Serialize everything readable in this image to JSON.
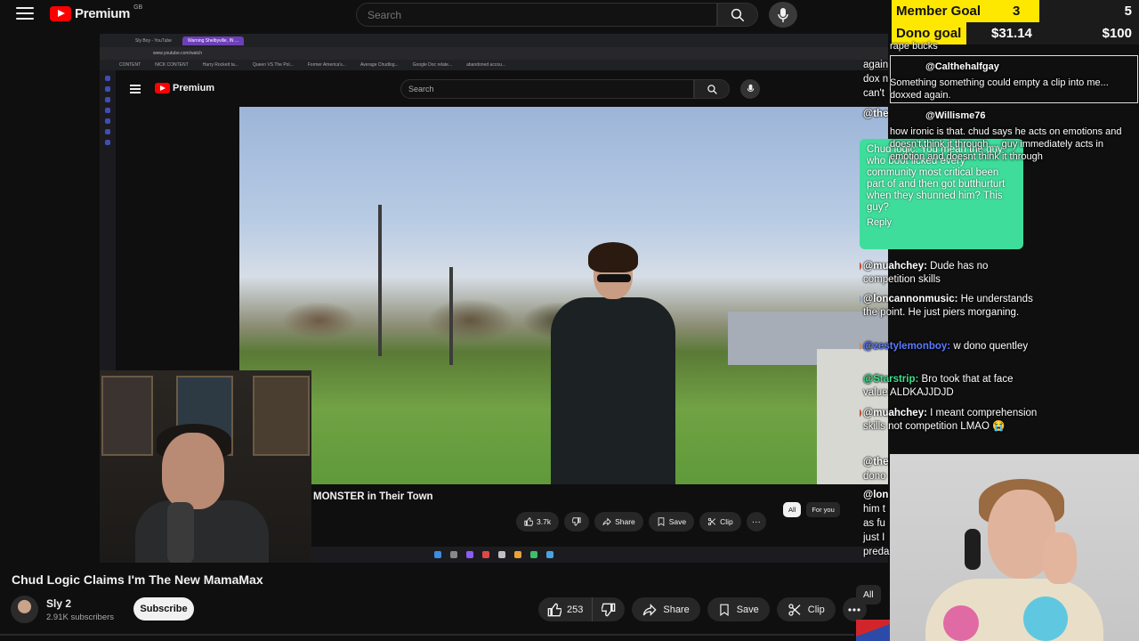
{
  "header": {
    "logo_text": "Premium",
    "logo_region": "GB",
    "search_placeholder": "Search"
  },
  "goals": {
    "member_label": "Member Goal",
    "member_current": "3",
    "member_target": "5",
    "dono_label": "Dono goal",
    "dono_current": "$31.14",
    "dono_target": "$100"
  },
  "capture": {
    "tabs": [
      "Sly Boy - YouTube",
      "Warning Shelbyville, IN ..."
    ],
    "url": "www.youtube.com/watch",
    "bookmarks": [
      "CONTENT",
      "NICK CONTENT",
      "Harry Rockett ta...",
      "Queen VS The Pol...",
      "Former America's...",
      "Average Chudlog...",
      "Google Doc relate...",
      "abandoned accou..."
    ],
    "logo_text": "Premium",
    "logo_region": "GB",
    "search_placeholder": "Search",
    "video_title": "MONSTER in Their Town",
    "like_count": "3.7k",
    "share_label": "Share",
    "save_label": "Save",
    "clip_label": "Clip",
    "chips": [
      "All",
      "For you"
    ]
  },
  "chat": {
    "top_fragments": [
      "again",
      "dox n",
      "can't"
    ],
    "top_user": "@the",
    "pinned_text": "Chud logic: You mean the guy who boot licked every community most critical been part of and then got butthurturt when they shunned him? This guy?",
    "pinned_reply": "Reply",
    "messages": [
      {
        "user": "@muahchey:",
        "text": "Dude has no competition skills",
        "color": "white"
      },
      {
        "user": "@loncannonmusic:",
        "text": "He understands the point. He just piers morganing.",
        "color": "white"
      },
      {
        "user": "@zestylemonboy:",
        "text": "w dono quentley",
        "color": "blue"
      },
      {
        "user": "@Starstrip:",
        "text": "Bro took that at face value ALDKAJJDJD",
        "color": "green"
      },
      {
        "user": "@muahchey:",
        "text": "I meant comprehension skills not competition LMAO 😭",
        "color": "white"
      }
    ],
    "bottom_fragments": [
      "@the",
      "dono",
      "@lon",
      "him t",
      "as fu",
      "just I",
      "preda"
    ]
  },
  "tts": {
    "line0": "rape bucks",
    "user1": "@Calthehalfgay",
    "text1": "Something something could empty a clip into me... doxxed again.",
    "user2": "@Willisme76",
    "text2": "how ironic is that. chud says he acts on emotions and doesn't think it through.... guy immediately acts in emotion and doesnt think it through"
  },
  "video": {
    "title": "Chud Logic Claims I'm The New MamaMax",
    "channel": "Sly 2",
    "subscribers": "2.91K subscribers",
    "subscribe_label": "Subscribe",
    "like_count": "253",
    "share_label": "Share",
    "save_label": "Save",
    "clip_label": "Clip",
    "chip_all": "All"
  },
  "colors": {
    "goal_yellow": "#ffe800",
    "pinned_green": "#3fdd9c",
    "youtube_red": "#ff0000",
    "background": "#0f0f0f"
  },
  "icons": [
    "menu-icon",
    "youtube-logo-icon",
    "search-icon",
    "mic-icon",
    "like-icon",
    "dislike-icon",
    "share-icon",
    "save-icon",
    "clip-icon",
    "more-icon"
  ]
}
